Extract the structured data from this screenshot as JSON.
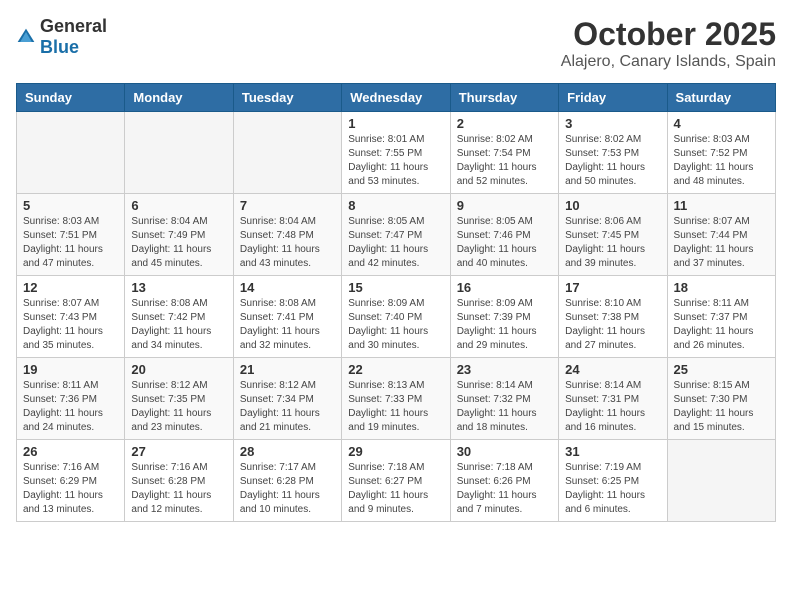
{
  "header": {
    "logo_general": "General",
    "logo_blue": "Blue",
    "month": "October 2025",
    "location": "Alajero, Canary Islands, Spain"
  },
  "days_of_week": [
    "Sunday",
    "Monday",
    "Tuesday",
    "Wednesday",
    "Thursday",
    "Friday",
    "Saturday"
  ],
  "weeks": [
    [
      {
        "day": "",
        "info": ""
      },
      {
        "day": "",
        "info": ""
      },
      {
        "day": "",
        "info": ""
      },
      {
        "day": "1",
        "info": "Sunrise: 8:01 AM\nSunset: 7:55 PM\nDaylight: 11 hours\nand 53 minutes."
      },
      {
        "day": "2",
        "info": "Sunrise: 8:02 AM\nSunset: 7:54 PM\nDaylight: 11 hours\nand 52 minutes."
      },
      {
        "day": "3",
        "info": "Sunrise: 8:02 AM\nSunset: 7:53 PM\nDaylight: 11 hours\nand 50 minutes."
      },
      {
        "day": "4",
        "info": "Sunrise: 8:03 AM\nSunset: 7:52 PM\nDaylight: 11 hours\nand 48 minutes."
      }
    ],
    [
      {
        "day": "5",
        "info": "Sunrise: 8:03 AM\nSunset: 7:51 PM\nDaylight: 11 hours\nand 47 minutes."
      },
      {
        "day": "6",
        "info": "Sunrise: 8:04 AM\nSunset: 7:49 PM\nDaylight: 11 hours\nand 45 minutes."
      },
      {
        "day": "7",
        "info": "Sunrise: 8:04 AM\nSunset: 7:48 PM\nDaylight: 11 hours\nand 43 minutes."
      },
      {
        "day": "8",
        "info": "Sunrise: 8:05 AM\nSunset: 7:47 PM\nDaylight: 11 hours\nand 42 minutes."
      },
      {
        "day": "9",
        "info": "Sunrise: 8:05 AM\nSunset: 7:46 PM\nDaylight: 11 hours\nand 40 minutes."
      },
      {
        "day": "10",
        "info": "Sunrise: 8:06 AM\nSunset: 7:45 PM\nDaylight: 11 hours\nand 39 minutes."
      },
      {
        "day": "11",
        "info": "Sunrise: 8:07 AM\nSunset: 7:44 PM\nDaylight: 11 hours\nand 37 minutes."
      }
    ],
    [
      {
        "day": "12",
        "info": "Sunrise: 8:07 AM\nSunset: 7:43 PM\nDaylight: 11 hours\nand 35 minutes."
      },
      {
        "day": "13",
        "info": "Sunrise: 8:08 AM\nSunset: 7:42 PM\nDaylight: 11 hours\nand 34 minutes."
      },
      {
        "day": "14",
        "info": "Sunrise: 8:08 AM\nSunset: 7:41 PM\nDaylight: 11 hours\nand 32 minutes."
      },
      {
        "day": "15",
        "info": "Sunrise: 8:09 AM\nSunset: 7:40 PM\nDaylight: 11 hours\nand 30 minutes."
      },
      {
        "day": "16",
        "info": "Sunrise: 8:09 AM\nSunset: 7:39 PM\nDaylight: 11 hours\nand 29 minutes."
      },
      {
        "day": "17",
        "info": "Sunrise: 8:10 AM\nSunset: 7:38 PM\nDaylight: 11 hours\nand 27 minutes."
      },
      {
        "day": "18",
        "info": "Sunrise: 8:11 AM\nSunset: 7:37 PM\nDaylight: 11 hours\nand 26 minutes."
      }
    ],
    [
      {
        "day": "19",
        "info": "Sunrise: 8:11 AM\nSunset: 7:36 PM\nDaylight: 11 hours\nand 24 minutes."
      },
      {
        "day": "20",
        "info": "Sunrise: 8:12 AM\nSunset: 7:35 PM\nDaylight: 11 hours\nand 23 minutes."
      },
      {
        "day": "21",
        "info": "Sunrise: 8:12 AM\nSunset: 7:34 PM\nDaylight: 11 hours\nand 21 minutes."
      },
      {
        "day": "22",
        "info": "Sunrise: 8:13 AM\nSunset: 7:33 PM\nDaylight: 11 hours\nand 19 minutes."
      },
      {
        "day": "23",
        "info": "Sunrise: 8:14 AM\nSunset: 7:32 PM\nDaylight: 11 hours\nand 18 minutes."
      },
      {
        "day": "24",
        "info": "Sunrise: 8:14 AM\nSunset: 7:31 PM\nDaylight: 11 hours\nand 16 minutes."
      },
      {
        "day": "25",
        "info": "Sunrise: 8:15 AM\nSunset: 7:30 PM\nDaylight: 11 hours\nand 15 minutes."
      }
    ],
    [
      {
        "day": "26",
        "info": "Sunrise: 7:16 AM\nSunset: 6:29 PM\nDaylight: 11 hours\nand 13 minutes."
      },
      {
        "day": "27",
        "info": "Sunrise: 7:16 AM\nSunset: 6:28 PM\nDaylight: 11 hours\nand 12 minutes."
      },
      {
        "day": "28",
        "info": "Sunrise: 7:17 AM\nSunset: 6:28 PM\nDaylight: 11 hours\nand 10 minutes."
      },
      {
        "day": "29",
        "info": "Sunrise: 7:18 AM\nSunset: 6:27 PM\nDaylight: 11 hours\nand 9 minutes."
      },
      {
        "day": "30",
        "info": "Sunrise: 7:18 AM\nSunset: 6:26 PM\nDaylight: 11 hours\nand 7 minutes."
      },
      {
        "day": "31",
        "info": "Sunrise: 7:19 AM\nSunset: 6:25 PM\nDaylight: 11 hours\nand 6 minutes."
      },
      {
        "day": "",
        "info": ""
      }
    ]
  ]
}
